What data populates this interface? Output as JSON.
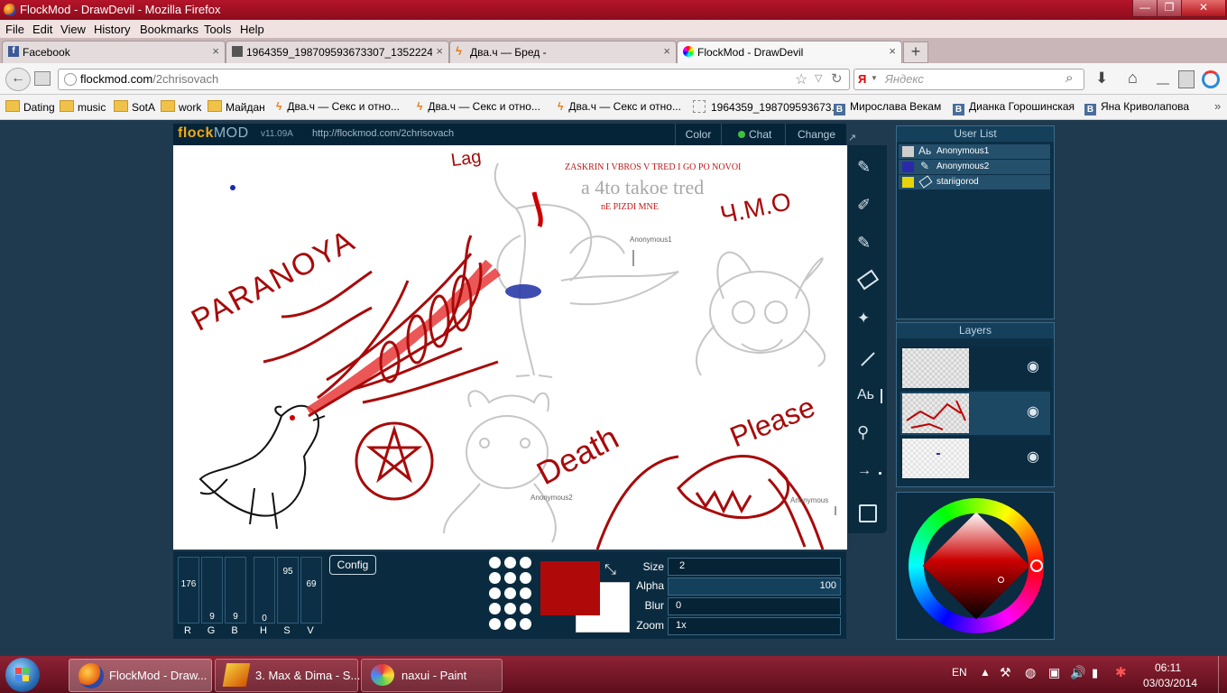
{
  "window": {
    "title": "FlockMod - DrawDevil - Mozilla Firefox",
    "controls": {
      "minimize": "—",
      "maximize": "❐",
      "close": "✕"
    }
  },
  "menubar": [
    "File",
    "Edit",
    "View",
    "History",
    "Bookmarks",
    "Tools",
    "Help"
  ],
  "tabs": [
    {
      "label": "Facebook",
      "icon": "facebook-icon"
    },
    {
      "label": "1964359_198709593673307_135222472...",
      "icon": "photo-icon"
    },
    {
      "label": "Два.ч — Бред -",
      "icon": "lightning-icon"
    },
    {
      "label": "FlockMod - DrawDevil",
      "icon": "flockmod-icon"
    }
  ],
  "navbar": {
    "url_host": "flockmod.com",
    "url_path": "/2chrisovach",
    "search_placeholder": "Яндекс"
  },
  "bookmarks": [
    {
      "label": "Dating",
      "type": "folder"
    },
    {
      "label": "music",
      "type": "folder"
    },
    {
      "label": "SotA",
      "type": "folder"
    },
    {
      "label": "work",
      "type": "folder"
    },
    {
      "label": "Майдан",
      "type": "folder"
    },
    {
      "label": "Два.ч — Секс и отно...",
      "type": "lightning"
    },
    {
      "label": "Два.ч — Секс и отно...",
      "type": "lightning"
    },
    {
      "label": "Два.ч — Секс и отно...",
      "type": "lightning"
    },
    {
      "label": "1964359_198709593673...",
      "type": "page"
    },
    {
      "label": "Мирославa Векам",
      "type": "vk"
    },
    {
      "label": "Дианка Горошинская",
      "type": "vk"
    },
    {
      "label": "Яна Криволапова",
      "type": "vk"
    }
  ],
  "app": {
    "logo_a": "flock",
    "logo_b": "MOD",
    "version": "v11.09A",
    "room_url": "http://flockmod.com/2chrisovach",
    "header_buttons": [
      "Color",
      "Chat",
      "Change"
    ],
    "canvas_texts": {
      "t1": "ZASKRIN I VBROS V TRED I GO PO NOVOI",
      "t2": "a 4to takoe tred",
      "t3": "nE PIZDI MNE",
      "t4": "Lag",
      "t5": "Ч.М.О",
      "t6": "PARANOYA",
      "t7": "Death",
      "t8": "Please",
      "cursor1": "Anonymous1",
      "cursor2": "Anonymous2",
      "cursor3": "Anonymous"
    },
    "user_list": {
      "title": "User List",
      "users": [
        {
          "name": "Anonymous1",
          "color": "#cfcfcf"
        },
        {
          "name": "Anonymous2",
          "color": "#2a2aa8"
        },
        {
          "name": "stariigorod",
          "color": "#e8d40a"
        }
      ]
    },
    "layers": {
      "title": "Layers",
      "count": 3
    },
    "color_sliders": [
      {
        "label": "R",
        "value": "176"
      },
      {
        "label": "G",
        "value": "9"
      },
      {
        "label": "B",
        "value": "9"
      },
      {
        "label": "H",
        "value": "0"
      },
      {
        "label": "S",
        "value": "95"
      },
      {
        "label": "V",
        "value": "69"
      }
    ],
    "config_label": "Config",
    "primary_color": "#b00909",
    "secondary_color": "#ffffff",
    "fields": [
      {
        "label": "Size",
        "value": "2"
      },
      {
        "label": "Alpha",
        "value": "100"
      },
      {
        "label": "Blur",
        "value": "0"
      },
      {
        "label": "Zoom",
        "value": "1x"
      }
    ]
  },
  "taskbar": {
    "items": [
      {
        "label": "FlockMod - Draw...",
        "icon": "firefox-icon"
      },
      {
        "label": "3. Max & Dima - S...",
        "icon": "winamp-icon"
      },
      {
        "label": "naxui - Paint",
        "icon": "paint-icon"
      }
    ],
    "lang": "EN",
    "time": "06:11",
    "date": "03/03/2014"
  }
}
